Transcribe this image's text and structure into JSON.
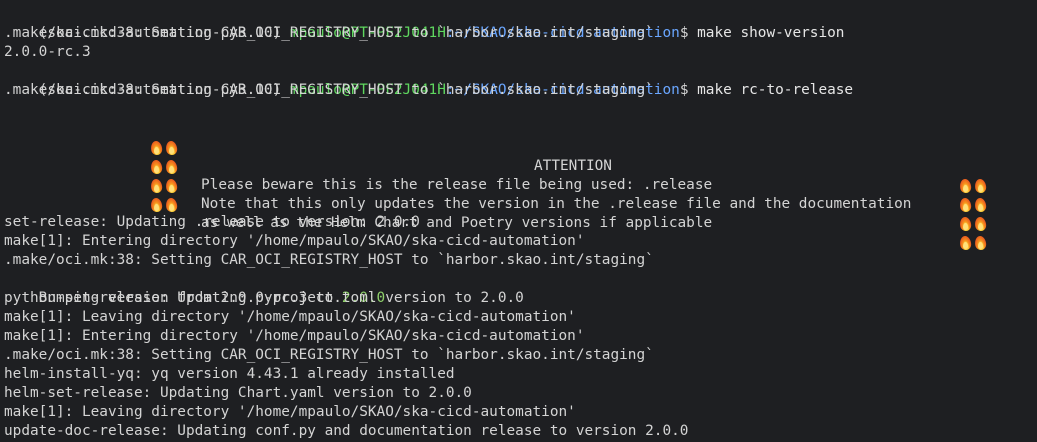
{
  "prompt": {
    "env": "(ska-cicd-automation-py3.10)",
    "user_host": "mpaulo@PT-PF2J041H",
    "path": ":~/SKAO/ska-cicd-automation",
    "dollar": "$"
  },
  "commands": {
    "first": " make show-version",
    "second": " make rc-to-release"
  },
  "output": {
    "oci_line": ".make/oci.mk:38: Setting CAR_OCI_REGISTRY_HOST to `harbor.skao.int/staging`",
    "version": "2.0.0-rc.3"
  },
  "banner": {
    "title": "ATTENTION",
    "line1": "Please beware this is the release file being used: .release",
    "line2": "Note that this only updates the version in the .release file and the documentation",
    "line3": "as well as the Helm Chart and Poetry versions if applicable",
    "icon": "fire-emoji"
  },
  "log": {
    "l1": "set-release: Updating .release to version: 2.0.0",
    "l2": "make[1]: Entering directory '/home/mpaulo/SKAO/ska-cicd-automation'",
    "l3": ".make/oci.mk:38: Setting CAR_OCI_REGISTRY_HOST to `harbor.skao.int/staging`",
    "l4_prefix": "Bumping version from 2.0.0-rc.3 to ",
    "l4_value": "2.0.0",
    "l5": "python-set-release: Updating pyproject.toml version to 2.0.0",
    "l6": "make[1]: Leaving directory '/home/mpaulo/SKAO/ska-cicd-automation'",
    "l7": "make[1]: Entering directory '/home/mpaulo/SKAO/ska-cicd-automation'",
    "l8": ".make/oci.mk:38: Setting CAR_OCI_REGISTRY_HOST to `harbor.skao.int/staging`",
    "l9": "helm-install-yq: yq version 4.43.1 already installed",
    "l10": "helm-set-release: Updating Chart.yaml version to 2.0.0",
    "l11": "make[1]: Leaving directory '/home/mpaulo/SKAO/ska-cicd-automation'",
    "l12": "update-doc-release: Updating conf.py and documentation release to version 2.0.0"
  },
  "colors": {
    "background": "#1e1f22",
    "text": "#d4d4d4",
    "user_host": "#5fd75f",
    "path": "#6aa6ff",
    "highlight_version": "#8fd16b"
  }
}
